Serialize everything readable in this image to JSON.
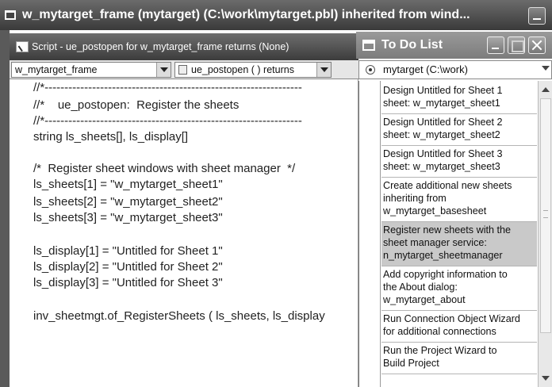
{
  "outer_window": {
    "title": "w_mytarget_frame (mytarget) (C:\\work\\mytarget.pbl) inherited from wind..."
  },
  "script_window": {
    "title": "Script - ue_postopen for w_mytarget_frame returns (None)",
    "object_combo": "w_mytarget_frame",
    "event_combo": "ue_postopen ( ) returns",
    "code_lines": [
      "//*-----------------------------------------------------------------",
      "//*    ue_postopen:  Register the sheets",
      "//*-----------------------------------------------------------------",
      "string ls_sheets[], ls_display[]",
      "",
      "/*  Register sheet windows with sheet manager  */",
      "ls_sheets[1] = \"w_mytarget_sheet1\"",
      "ls_sheets[2] = \"w_mytarget_sheet2\"",
      "ls_sheets[3] = \"w_mytarget_sheet3\"",
      "",
      "ls_display[1] = \"Untitled for Sheet 1\"",
      "ls_display[2] = \"Untitled for Sheet 2\"",
      "ls_display[3] = \"Untitled for Sheet 3\"",
      "",
      "inv_sheetmgt.of_RegisterSheets ( ls_sheets, ls_display"
    ]
  },
  "todo_window": {
    "title": "To Do List",
    "target": "mytarget (C:\\work)",
    "items": [
      "Design Untitled for Sheet 1\nsheet: w_mytarget_sheet1",
      "Design Untitled for Sheet 2\nsheet: w_mytarget_sheet2",
      "Design Untitled for Sheet 3\nsheet: w_mytarget_sheet3",
      "Create additional new sheets\ninheriting from\nw_mytarget_basesheet",
      "Register new sheets with the\nsheet manager service:\nn_mytarget_sheetmanager",
      "Add copyright information to\nthe About dialog:\nw_mytarget_about",
      "Run Connection Object Wizard\nfor additional connections",
      "Run the Project Wizard to\nBuild Project"
    ],
    "selected_index": 4
  }
}
